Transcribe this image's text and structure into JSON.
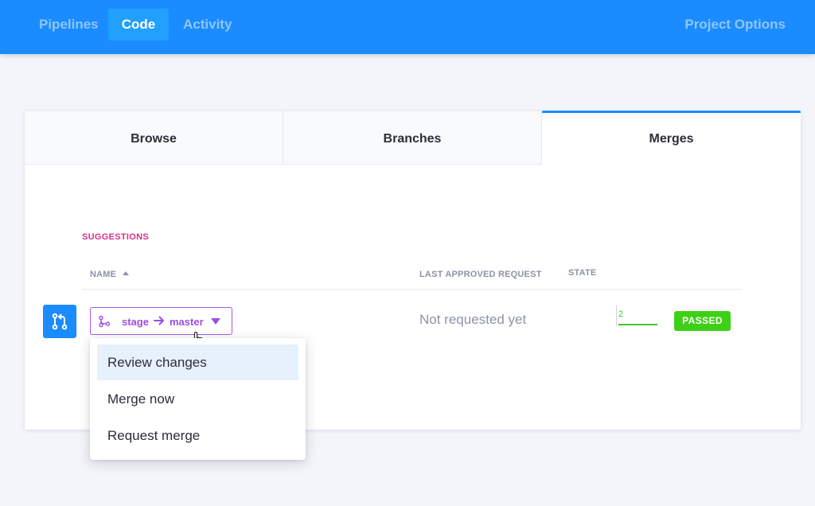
{
  "nav": {
    "items": [
      {
        "label": "Pipelines",
        "active": false
      },
      {
        "label": "Code",
        "active": true
      },
      {
        "label": "Activity",
        "active": false
      }
    ],
    "right_label": "Project Options"
  },
  "tabs": [
    {
      "label": "Browse",
      "active": false
    },
    {
      "label": "Branches",
      "active": false
    },
    {
      "label": "Merges",
      "active": true
    }
  ],
  "section": {
    "title": "SUGGESTIONS",
    "columns": {
      "name": "NAME",
      "last_approved": "LAST APPROVED REQUEST",
      "state": "STATE"
    },
    "sort_icon": "sort-ascending-icon"
  },
  "row": {
    "icon": "pull-request-icon",
    "source_branch": "stage",
    "target_branch": "master",
    "last_approved_request": "Not requested yet",
    "state_count": "2",
    "state_badge": "PASSED"
  },
  "dropdown": {
    "items": [
      {
        "label": "Review changes",
        "highlighted": true
      },
      {
        "label": "Merge now",
        "highlighted": false
      },
      {
        "label": "Request merge",
        "highlighted": false
      }
    ]
  },
  "colors": {
    "brand_blue": "#1a8cff",
    "branch_purple": "#9b4fe0",
    "section_pink": "#d4338a",
    "success_green": "#3ed016"
  }
}
